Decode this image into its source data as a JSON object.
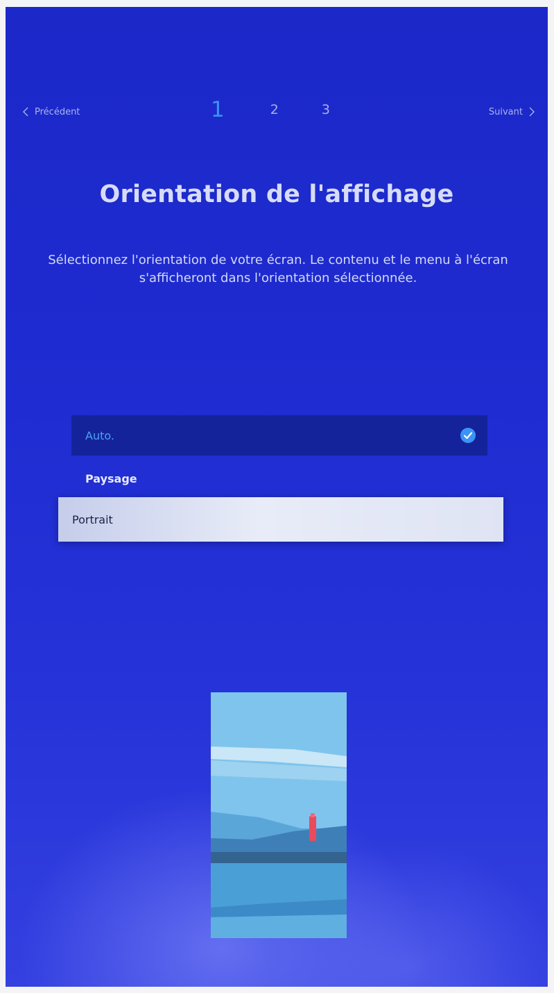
{
  "nav": {
    "prev_label": "Précédent",
    "next_label": "Suivant",
    "steps": [
      "1",
      "2",
      "3"
    ],
    "active_step": "1"
  },
  "header": {
    "title": "Orientation de l'affichage",
    "subtitle": "Sélectionnez l'orientation de votre écran. Le contenu et le menu à l'écran s'afficheront dans l'orientation sélectionnée."
  },
  "options": {
    "auto_label": "Auto.",
    "paysage_label": "Paysage",
    "portrait_label": "Portrait",
    "selected": "Auto.",
    "focused": "Portrait"
  },
  "icons": {
    "prev": "chevron-left-icon",
    "next": "chevron-right-icon",
    "selected": "check-circle-icon",
    "preview": "portrait-preview-illustration"
  },
  "colors": {
    "background": "#1e2bd0",
    "accent": "#3b93f5",
    "selected_row": "#15239a",
    "focused_row": "#e8ecf8"
  }
}
